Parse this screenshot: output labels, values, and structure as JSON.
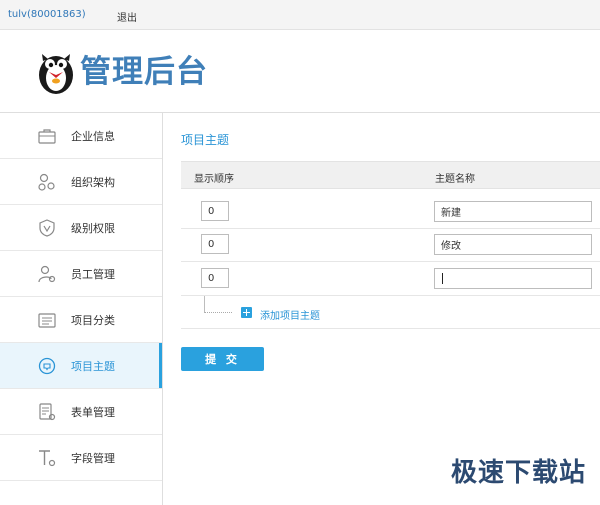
{
  "topbar": {
    "user": "tulv(80001863)",
    "logout": "退出"
  },
  "header": {
    "logo_text": "管理后台"
  },
  "sidebar": {
    "items": [
      {
        "label": "企业信息",
        "icon": "briefcase-icon"
      },
      {
        "label": "组织架构",
        "icon": "org-chart-icon"
      },
      {
        "label": "级别权限",
        "icon": "shield-icon"
      },
      {
        "label": "员工管理",
        "icon": "user-gear-icon"
      },
      {
        "label": "项目分类",
        "icon": "list-icon"
      },
      {
        "label": "项目主题",
        "icon": "chat-bubble-icon",
        "active": true
      },
      {
        "label": "表单管理",
        "icon": "form-icon"
      },
      {
        "label": "字段管理",
        "icon": "text-field-icon"
      }
    ]
  },
  "main": {
    "title": "项目主题",
    "columns": {
      "order": "显示顺序",
      "name": "主题名称"
    },
    "rows": [
      {
        "order": "0",
        "name": "新建"
      },
      {
        "order": "0",
        "name": "修改"
      },
      {
        "order": "0",
        "name": ""
      }
    ],
    "add_label": "添加项目主题",
    "submit_label": "提 交"
  },
  "watermark": "极速下载站",
  "colors": {
    "accent": "#2aa1de",
    "logo": "#3f7fb8",
    "link": "#2f77b8"
  }
}
